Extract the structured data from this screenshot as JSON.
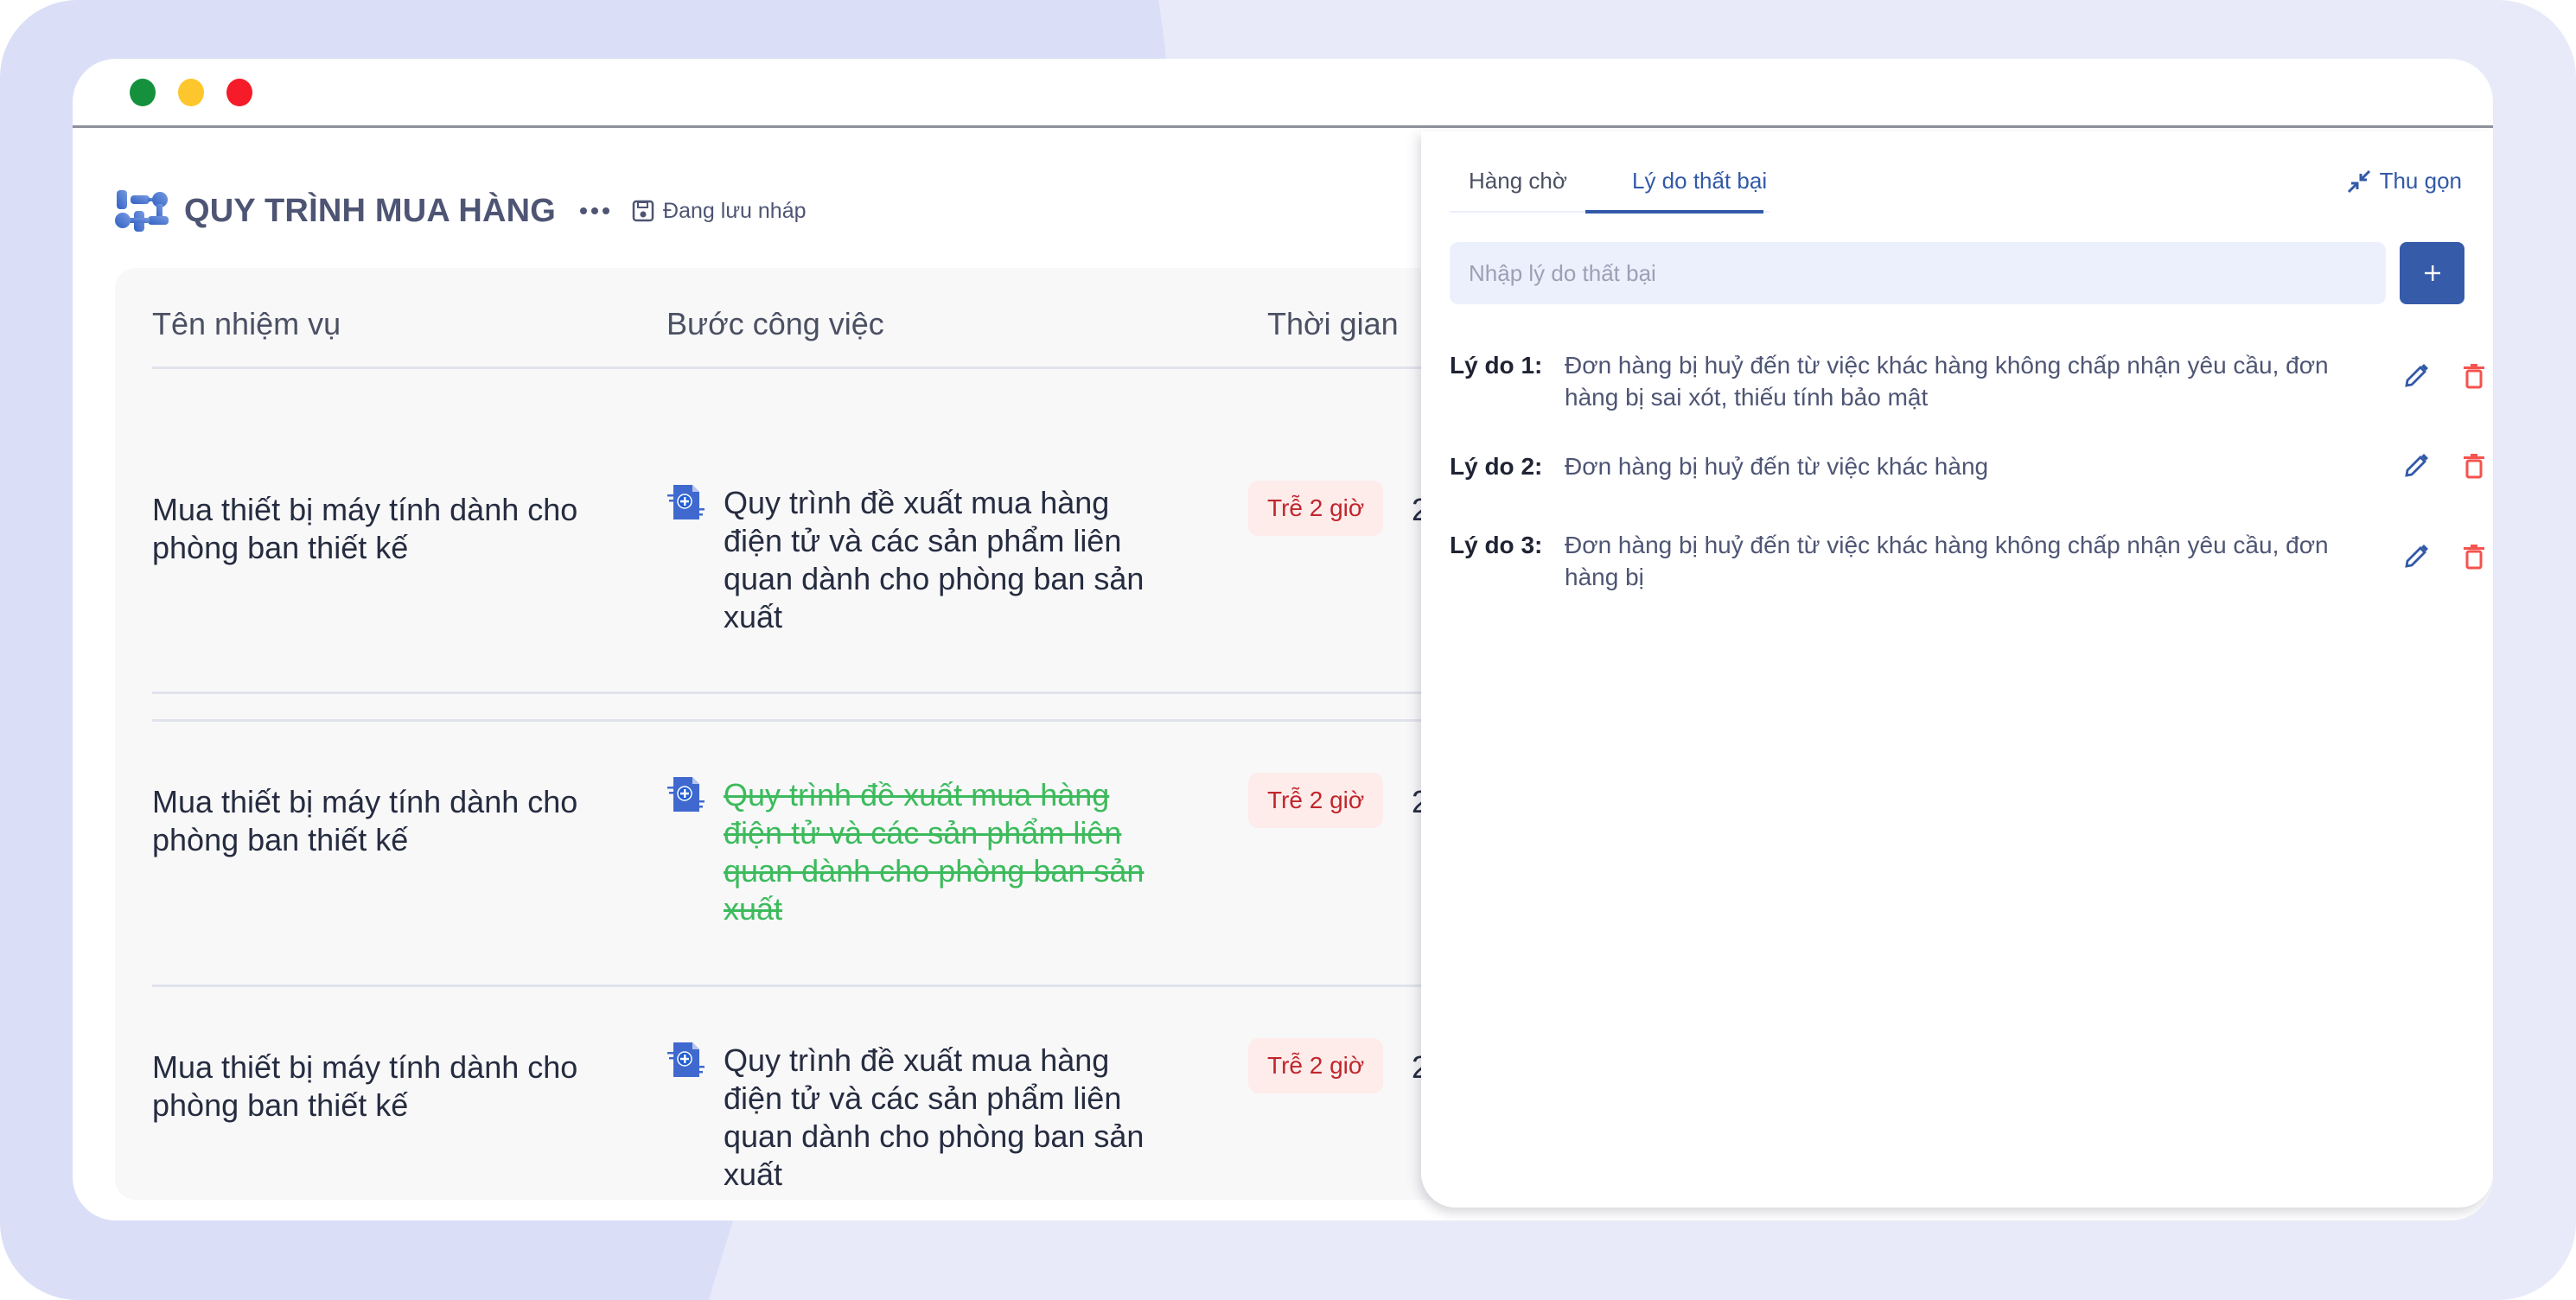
{
  "window": {
    "controls": [
      "close",
      "minimize",
      "maximize"
    ]
  },
  "header": {
    "title": "QUY TRÌNH MUA HÀNG",
    "more_icon": "more-horizontal-icon",
    "save_status": "Đang lưu nháp",
    "save_icon": "floppy-disk-icon"
  },
  "table": {
    "columns": [
      "Tên nhiệm vụ",
      "Bước công việc",
      "Thời gian"
    ],
    "rows": [
      {
        "task": "Mua thiết bị máy tính dành cho phòng ban thiết kế",
        "step": "Quy trình đề xuất mua hàng điện tử và các sản phẩm liên quan dành cho phòng ban sản xuất",
        "step_completed": false,
        "badge": "Trễ 2 giờ",
        "time_partial": "2"
      },
      {
        "task": "Mua thiết bị máy tính dành cho phòng ban thiết kế",
        "step": "Quy trình đề xuất mua hàng điện tử và các sản phẩm liên quan dành cho phòng ban sản xuất",
        "step_completed": true,
        "badge": "Trễ 2 giờ",
        "time_partial": "2"
      },
      {
        "task": "Mua thiết bị máy tính dành cho phòng ban thiết kế",
        "step": "Quy trình đề xuất mua hàng điện tử và các sản phẩm liên quan dành cho phòng ban sản xuất",
        "step_completed": false,
        "badge": "Trễ 2 giờ",
        "time_partial": "2"
      }
    ]
  },
  "panel": {
    "tabs": [
      {
        "label": "Hàng chờ",
        "active": false
      },
      {
        "label": "Lý do thất bại",
        "active": true
      }
    ],
    "collapse_label": "Thu gọn",
    "input": {
      "placeholder": "Nhập lý do thất bại",
      "value": ""
    },
    "add_button_icon": "plus-icon",
    "reasons": [
      {
        "label": "Lý do 1:",
        "text": "Đơn hàng bị huỷ đến từ việc khác hàng không chấp nhận yêu cầu, đơn hàng bị sai xót, thiếu tính bảo mật"
      },
      {
        "label": "Lý do 2:",
        "text": "Đơn hàng bị huỷ đến từ việc khác hàng"
      },
      {
        "label": "Lý do 3:",
        "text": "Đơn hàng bị huỷ đến từ việc khác hàng không chấp nhận yêu cầu, đơn hàng bị"
      }
    ]
  },
  "colors": {
    "accent": "#3259a8",
    "danger": "#f4534e",
    "badge_bg": "#fdecea",
    "badge_text": "#c0262d",
    "completed_text": "#3dbb5c"
  }
}
